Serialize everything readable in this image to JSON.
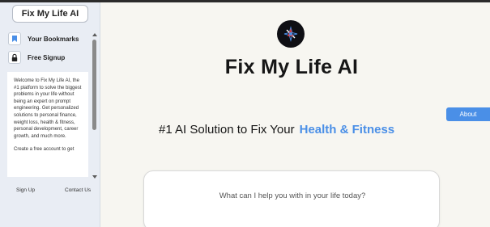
{
  "sidebar": {
    "brand": "Fix My Life AI",
    "items": [
      {
        "label": "Your Bookmarks",
        "icon": "bookmark-icon"
      },
      {
        "label": "Free Signup",
        "icon": "lock-icon"
      }
    ],
    "description": [
      "Welcome to Fix My Life AI, the #1 platform to solve the biggest problems in your life without being an expert on prompt engineering. Get personalized solutions to personal finance, weight loss, health & fitness, personal development, career growth, and much more.",
      "Create a free account to get"
    ],
    "footer": {
      "signup": "Sign Up",
      "contact": "Contact Us"
    }
  },
  "main": {
    "logo_icon": "logo-icon",
    "title": "Fix My Life AI",
    "about_label": "About",
    "tagline_prefix": "#1 AI Solution to Fix Your",
    "tagline_accent": "Health & Fitness",
    "prompt_placeholder": "What can I help you with in your life today?"
  },
  "colors": {
    "accent": "#4a8fe7",
    "sidebar_bg": "#e9edf4",
    "page_bg": "#f7f6f1"
  }
}
